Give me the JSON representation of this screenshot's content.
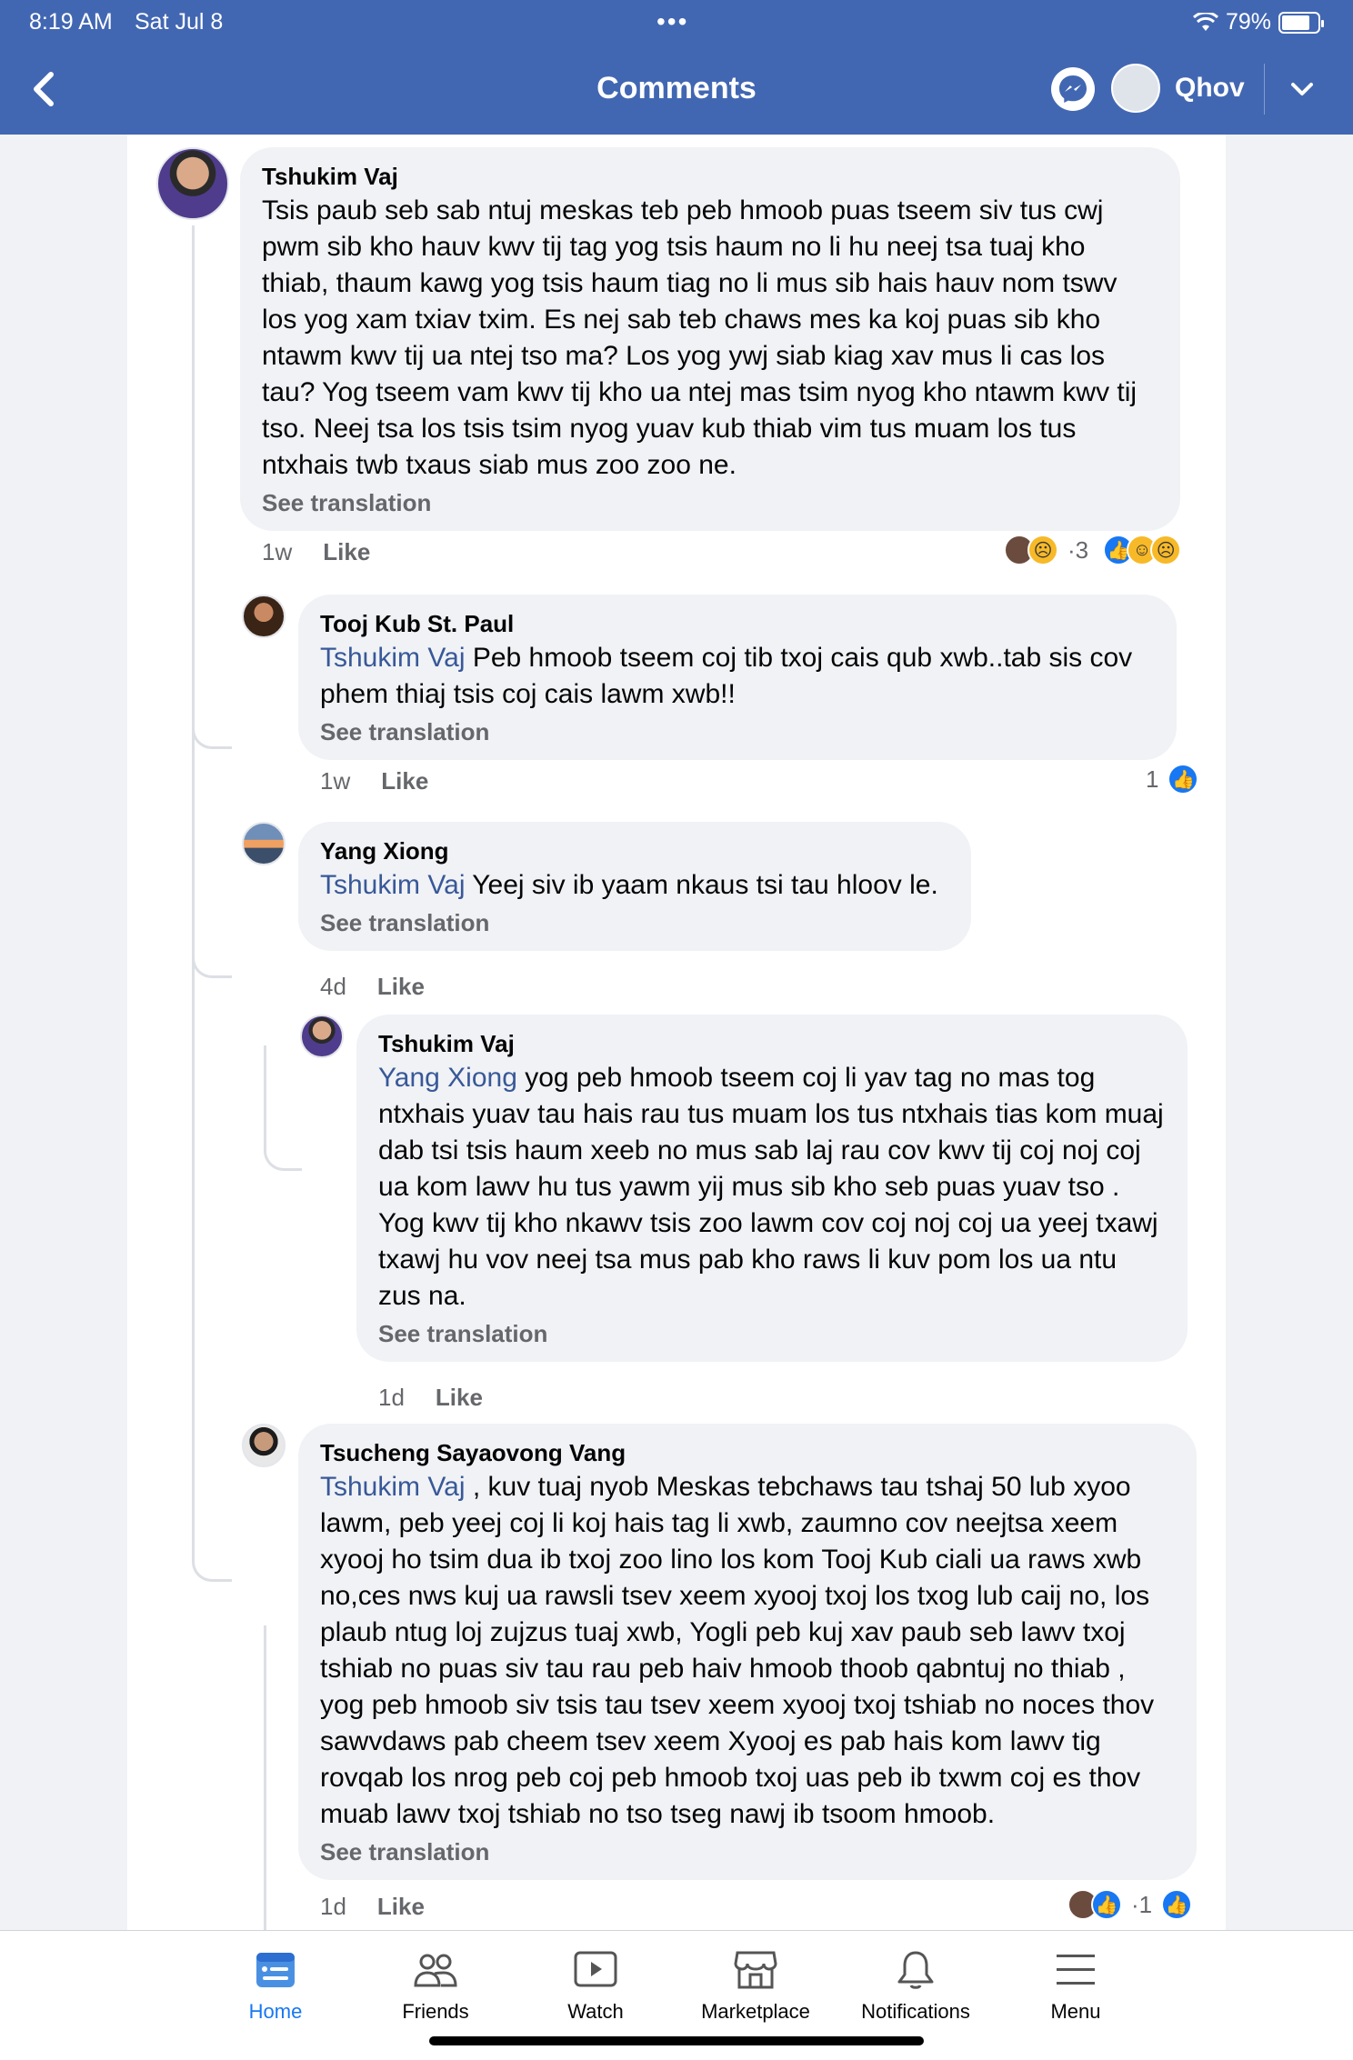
{
  "status_bar": {
    "time": "8:19 AM",
    "date": "Sat Jul 8",
    "dots": "•••",
    "battery": "79%",
    "battery_level": 0.79
  },
  "header": {
    "title": "Comments",
    "profile_name": "Qhov"
  },
  "comments": [
    {
      "author": "Tshukim Vaj",
      "text": "Tsis paub seb sab ntuj meskas teb peb hmoob puas tseem siv tus cwj pwm sib kho hauv kwv tij tag yog tsis haum no li hu neej tsa tuaj kho thiab, thaum kawg yog tsis haum tiag no li mus sib hais hauv nom tswv los yog xam txiav txim. Es nej sab teb chaws mes ka koj puas sib kho ntawm kwv tij ua ntej tso ma? Los yog ywj siab kiag xav mus li cas los tau? Yog tseem vam kwv tij kho ua ntej mas tsim nyog kho ntawm kwv tij tso. Neej tsa los tsis tsim nyog yuav kub thiab vim tus muam los tus ntxhais twb txaus siab mus zoo zoo ne.",
      "see_translation": "See translation",
      "time": "1w",
      "like": "Like",
      "reactions_sep": "· ",
      "reaction_count": "3"
    },
    {
      "author": "Tooj Kub St. Paul",
      "mention": "Tshukim Vaj",
      "text": " Peb hmoob tseem coj tib txoj cais qub xwb..tab sis cov phem thiaj tsis coj cais lawm xwb!!",
      "see_translation": "See translation",
      "time": "1w",
      "like": "Like",
      "reaction_count": "1"
    },
    {
      "author": "Yang Xiong",
      "mention": "Tshukim Vaj",
      "text": " Yeej siv ib yaam nkaus tsi tau hloov le.",
      "see_translation": "See translation",
      "time": "4d",
      "like": "Like"
    },
    {
      "author": "Tshukim Vaj",
      "mention": "Yang Xiong",
      "text": " yog peb hmoob tseem coj li yav tag no mas tog ntxhais yuav tau hais rau tus muam los tus ntxhais tias kom muaj dab tsi tsis haum xeeb no mus sab laj rau cov kwv tij coj noj coj ua kom lawv hu tus yawm yij mus sib kho seb puas yuav tso . Yog kwv tij kho nkawv tsis zoo lawm cov coj noj coj ua yeej txawj txawj hu vov neej tsa mus pab kho raws li kuv pom los ua ntu zus na.",
      "see_translation": "See translation",
      "time": "1d",
      "like": "Like"
    },
    {
      "author": "Tsucheng Sayaovong Vang",
      "mention": "Tshukim Vaj",
      "text": " , kuv tuaj nyob Meskas tebchaws tau tshaj 50 lub xyoo lawm, peb yeej coj li koj hais tag li xwb, zaumno cov neejtsa xeem xyooj ho tsim dua ib txoj zoo lino los kom Tooj Kub ciali ua raws xwb no,ces nws kuj ua rawsli tsev xeem xyooj txoj los txog lub caij no, los plaub ntug loj zujzus tuaj xwb, Yogli peb kuj xav paub seb lawv txoj tshiab no puas siv tau rau peb haiv hmoob thoob qabntuj no thiab , yog peb hmoob siv tsis tau tsev xeem xyooj txoj tshiab no noces thov sawvdaws pab cheem tsev xeem Xyooj es pab hais kom lawv tig rovqab los nrog peb coj peb hmoob txoj uas peb ib txwm coj es thov muab lawv txoj tshiab no tso tseg nawj ib tsoom hmoob.",
      "see_translation": "See translation",
      "time": "1d",
      "like": "Like",
      "reactions_sep": "· ",
      "reaction_count": "1"
    }
  ],
  "tabs": [
    {
      "label": "Home",
      "icon": "home-icon",
      "active": true
    },
    {
      "label": "Friends",
      "icon": "friends-icon"
    },
    {
      "label": "Watch",
      "icon": "watch-icon"
    },
    {
      "label": "Marketplace",
      "icon": "marketplace-icon"
    },
    {
      "label": "Notifications",
      "icon": "bell-icon"
    },
    {
      "label": "Menu",
      "icon": "menu-icon"
    }
  ],
  "colors": {
    "header": "#4267b2",
    "accent": "#1877f2",
    "mention": "#385898",
    "bubble": "#f0f2f5"
  }
}
